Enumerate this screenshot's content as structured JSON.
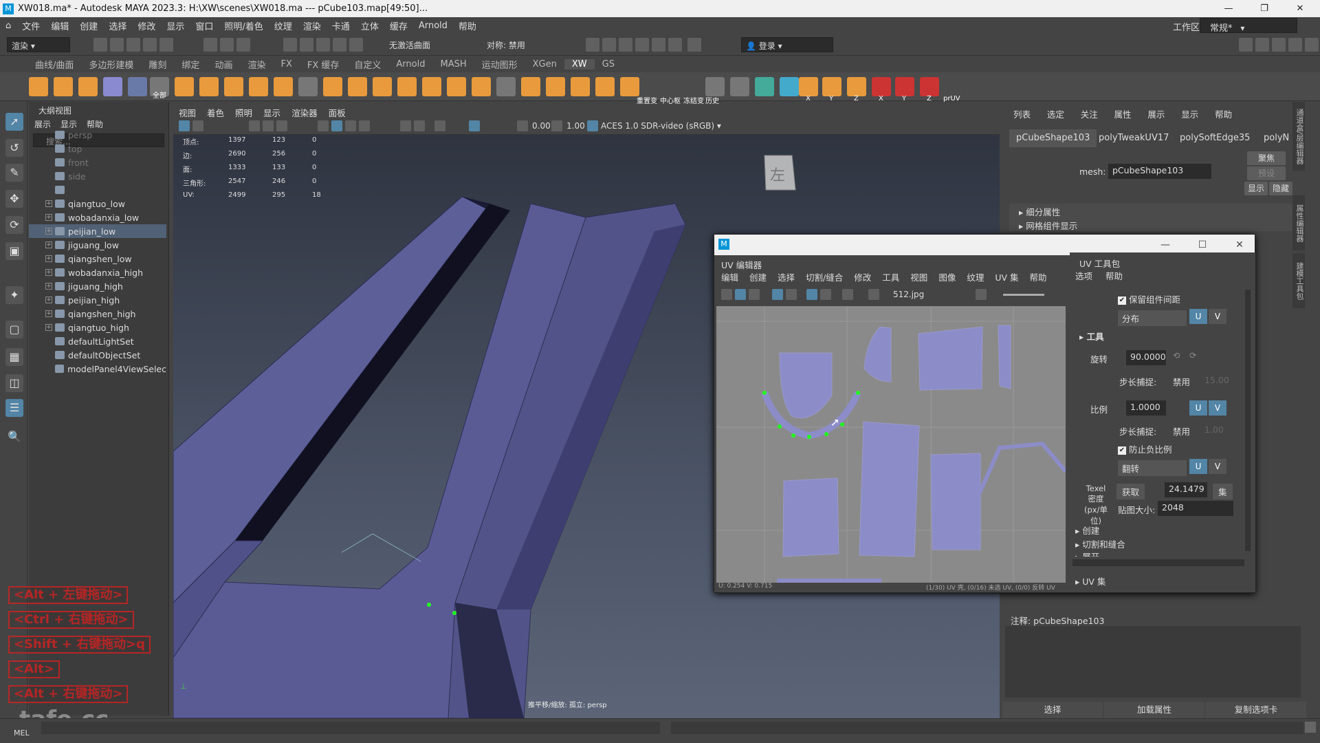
{
  "window": {
    "title": "XW018.ma* - Autodesk MAYA 2023.3: H:\\XW\\scenes\\XW018.ma   ---   pCube103.map[49:50]..."
  },
  "menubar": [
    "文件",
    "编辑",
    "创建",
    "选择",
    "修改",
    "显示",
    "窗口",
    "照明/着色",
    "纹理",
    "渲染",
    "卡通",
    "立体",
    "缓存",
    "Arnold",
    "帮助"
  ],
  "workspace": {
    "label": "工作区:",
    "value": "常规*"
  },
  "status": {
    "mode": "渲染",
    "no_live": "无激活曲面",
    "symmetry": "对称: 禁用",
    "login": "登录"
  },
  "shelf_tabs": [
    "曲线/曲面",
    "多边形建模",
    "雕刻",
    "绑定",
    "动画",
    "渲染",
    "FX",
    "FX 缓存",
    "自定义",
    "Arnold",
    "MASH",
    "运动图形",
    "XGen",
    "XW",
    "GS"
  ],
  "shelf_labels": {
    "all": "全部",
    "reset": "重置变",
    "center": "中心枢",
    "freeze": "冻结变",
    "history": "历史",
    "x1": "X",
    "y1": "Y",
    "z1": "Z",
    "x2": "X",
    "y2": "Y",
    "z2": "Z",
    "pruv": "prUV"
  },
  "outliner": {
    "title": "大纲视图",
    "menu": [
      "展示",
      "显示",
      "帮助"
    ],
    "search_placeholder": "搜索...",
    "items": [
      {
        "label": "persp",
        "dim": true
      },
      {
        "label": "top",
        "dim": true
      },
      {
        "label": "front",
        "dim": true
      },
      {
        "label": "side",
        "dim": true
      },
      {
        "label": "",
        "dim": true
      },
      {
        "label": "qiangtuo_low"
      },
      {
        "label": "wobadanxia_low"
      },
      {
        "label": "peijian_low",
        "selected": true
      },
      {
        "label": "jiguang_low"
      },
      {
        "label": "qiangshen_low"
      },
      {
        "label": "wobadanxia_high"
      },
      {
        "label": "jiguang_high"
      },
      {
        "label": "peijian_high"
      },
      {
        "label": "qiangshen_high"
      },
      {
        "label": "qiangtuo_high"
      },
      {
        "label": "defaultLightSet"
      },
      {
        "label": "defaultObjectSet"
      },
      {
        "label": "modelPanel4ViewSelec"
      }
    ]
  },
  "hotkeys": [
    "<Alt + 左键拖动>",
    "<Ctrl + 右键拖动>",
    "<Shift + 右键拖动>q",
    "<Alt>",
    "<Alt + 右键拖动>"
  ],
  "watermark": "tafe.cc",
  "mel_label": "MEL",
  "viewport": {
    "menu": [
      "视图",
      "着色",
      "照明",
      "显示",
      "渲染器",
      "面板"
    ],
    "exposure": "0.00",
    "gamma": "1.00",
    "colorspace": "ACES 1.0 SDR-video (sRGB)",
    "hud": [
      {
        "label": "顶点:",
        "a": "1397",
        "b": "123",
        "c": "0"
      },
      {
        "label": "边:",
        "a": "2690",
        "b": "256",
        "c": "0"
      },
      {
        "label": "面:",
        "a": "1333",
        "b": "133",
        "c": "0"
      },
      {
        "label": "三角形:",
        "a": "2547",
        "b": "246",
        "c": "0"
      },
      {
        "label": "UV:",
        "a": "2499",
        "b": "295",
        "c": "18"
      }
    ],
    "viewcube": "左",
    "bottom_label": "推平移/缩放: 孤立: persp"
  },
  "right_panel": {
    "tabs": [
      "列表",
      "选定",
      "关注",
      "属性",
      "展示",
      "显示",
      "帮助"
    ],
    "node_tabs": [
      "pCubeShape103",
      "polyTweakUV17",
      "polySoftEdge35",
      "polyN"
    ],
    "mesh_label": "mesh:",
    "mesh_value": "pCubeShape103",
    "focus": "聚焦",
    "preset": "预设",
    "show": "显示",
    "hide": "隐藏",
    "sections": [
      "细分属性",
      "网格组件显示"
    ],
    "notes_label": "注释: pCubeShape103",
    "bottom_buttons": [
      "选择",
      "加载属性",
      "复制选项卡"
    ],
    "side_tabs": [
      "通道盒/层编辑器",
      "属性编辑器",
      "建模工具包"
    ]
  },
  "uv_editor": {
    "title": "UV 编辑器",
    "menu": [
      "编辑",
      "创建",
      "选择",
      "切割/缝合",
      "修改",
      "工具",
      "视图",
      "图像",
      "纹理",
      "UV 集",
      "帮助"
    ],
    "image": "512.jpg",
    "status_left": "U: 0.254 V: 0.715",
    "status_right": "(1/30) UV 壳, (0/16) 未选 UV, (0/0) 反转 UV",
    "toolkit": {
      "title": "UV 工具包",
      "menu": [
        "选项",
        "帮助"
      ],
      "preserve": "保留组件间距",
      "distribute": "分布",
      "tools": "工具",
      "rotate_label": "旋转",
      "rotate_value": "90.0000",
      "step_label": "步长捕捉:",
      "disabled": "禁用",
      "step_val1": "15.00",
      "scale_label": "比例",
      "scale_value": "1.0000",
      "step_val2": "1.00",
      "prevent_neg": "防止负比例",
      "flip": "翻转",
      "texel_label": "Texel\n密度\n(px/单位)",
      "get": "获取",
      "texel_value": "24.1479",
      "set": "集",
      "map_size_label": "贴图大小:",
      "map_size": "2048",
      "create": "创建",
      "cut_sew": "切割和缝合",
      "unfold": "展开",
      "uvset": "UV 集",
      "u": "U",
      "v": "V"
    }
  }
}
